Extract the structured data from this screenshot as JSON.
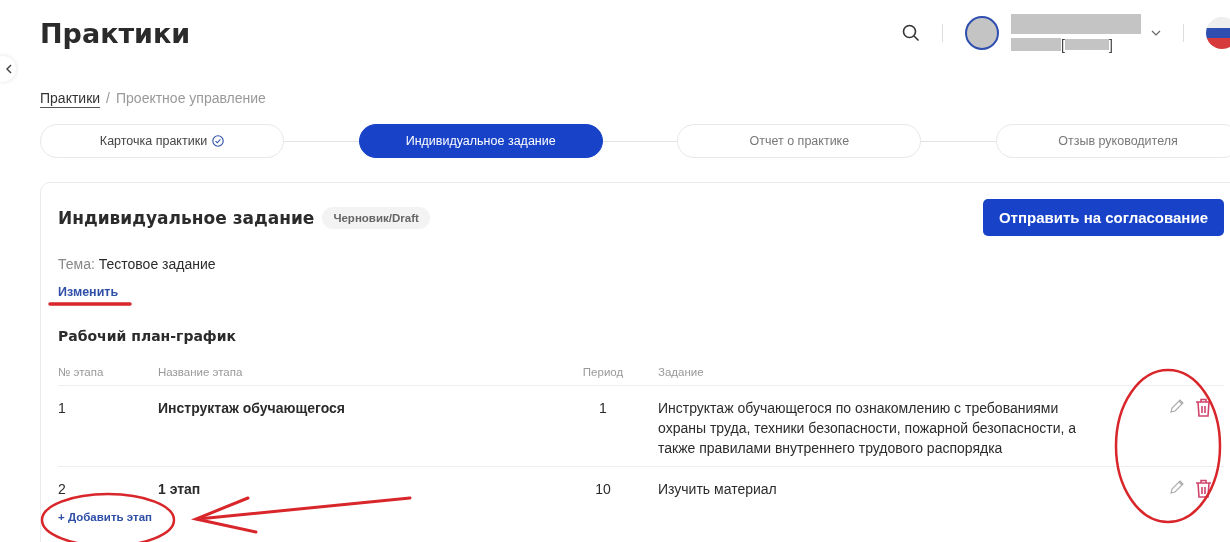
{
  "header": {
    "title": "Практики",
    "user": {
      "id_open": "[",
      "id_close": "]"
    }
  },
  "breadcrumb": [
    {
      "label": "Практики",
      "link": true
    },
    {
      "label": "/",
      "link": false
    },
    {
      "label": "Проектное управление",
      "link": false
    }
  ],
  "steps": [
    {
      "label": "Карточка практики",
      "selected": false,
      "done": true
    },
    {
      "label": "Индивидуальное задание",
      "selected": true,
      "done": false
    },
    {
      "label": "Отчет о практике",
      "selected": false,
      "done": false
    },
    {
      "label": "Отзыв руководителя",
      "selected": false,
      "done": false
    }
  ],
  "card": {
    "title": "Индивидуальное задание",
    "status": "Черновик/Draft",
    "submit_button": "Отправить на согласование",
    "topic_label": "Тема:",
    "topic_value": "Тестовое задание",
    "edit_link": "Изменить",
    "plan_title": "Рабочий план-график",
    "add_link": "+ Добавить этап"
  },
  "table": {
    "columns": [
      "№ этапа",
      "Название этапа",
      "Период",
      "Задание"
    ],
    "rows": [
      {
        "number": "1",
        "name": "Инструктаж обучающегося",
        "period": "1",
        "task": "Инструктаж обучающегося по ознакомлению с требованиями охраны труда, техники безопасности, пожарной безопасности, а также правилами внутреннего трудового распорядка"
      },
      {
        "number": "2",
        "name": "1 этап",
        "period": "10",
        "task": "Изучить материал"
      }
    ]
  }
}
